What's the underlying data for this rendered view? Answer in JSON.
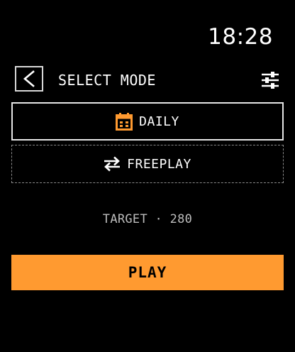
{
  "status_bar": {
    "time": "18:28"
  },
  "header": {
    "back_icon": "chevron-left-icon",
    "title": "SELECT MODE",
    "settings_icon": "sliders-icon"
  },
  "modes": [
    {
      "label": "DAILY",
      "icon": "calendar-icon",
      "selected": true
    },
    {
      "label": "FREEPLAY",
      "icon": "swap-arrows-icon",
      "selected": false
    }
  ],
  "target": {
    "text": "TARGET · 280"
  },
  "play_button": {
    "label": "PLAY"
  },
  "colors": {
    "background": "#000000",
    "accent": "#ff9a30",
    "text": "#ffffff",
    "muted_text": "#bdbdbd"
  }
}
